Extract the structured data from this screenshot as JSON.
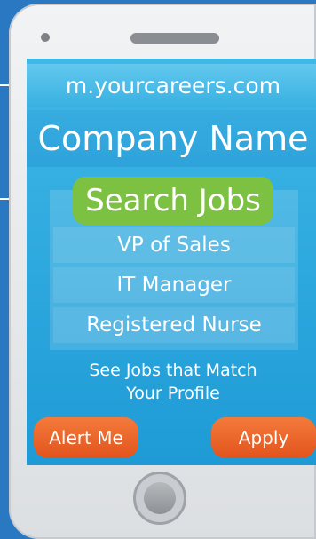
{
  "url": "m.yourcareers.com",
  "company_name": "Company Name",
  "search_label": "Search Jobs",
  "jobs": [
    {
      "title": "VP of Sales"
    },
    {
      "title": "IT Manager"
    },
    {
      "title": "Registered Nurse"
    }
  ],
  "match_text_line1": "See Jobs that Match",
  "match_text_line2": "Your Profile",
  "alert_label": "Alert Me",
  "apply_label": "Apply",
  "colors": {
    "background": "#2a78c2",
    "screen": "#1e9ad6",
    "search_button": "#7dc142",
    "action_buttons": "#e2541d"
  }
}
